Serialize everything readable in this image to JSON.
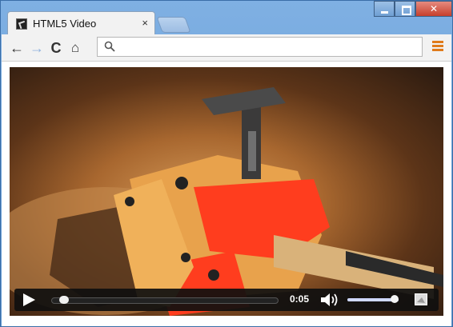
{
  "tab": {
    "title": "HTML5 Video",
    "close": "×"
  },
  "window": {
    "minimize": "",
    "maximize": "",
    "close": ""
  },
  "toolbar": {
    "back": "←",
    "forward": "→",
    "reload": "C",
    "home": "⌂",
    "address": ""
  },
  "video": {
    "time": "0:05",
    "progress": 0.02,
    "volume": 1.0,
    "colors": {
      "controls_bg": "#0f0f0f",
      "knob": "#f0f0f0",
      "volume_fill": "#cfd8ff"
    }
  },
  "icons": {
    "favicon": "video-favicon-icon",
    "search": "search-icon",
    "menu": "menu-icon",
    "play": "play-icon",
    "volume": "volume-icon",
    "fullscreen": "fullscreen-icon"
  }
}
